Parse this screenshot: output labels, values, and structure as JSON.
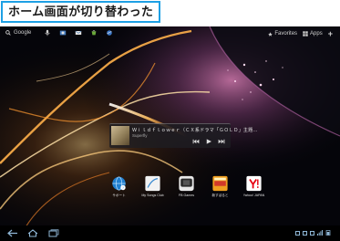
{
  "caption": "ホーム画面が切り替わった",
  "topbar": {
    "search_label": "Google",
    "favorites_label": "Favorites",
    "apps_label": "Apps",
    "add_label": "+"
  },
  "music_widget": {
    "title": "Ｗｉｌｄｆｌｏｗｅｒ（ＣＸ系ドラマ「ＧＯＬＤ」主題...",
    "artist": "Superfly"
  },
  "apps": [
    {
      "label": "サポート",
      "icon": "support-globe-icon",
      "color": "#1f7fd0"
    },
    {
      "label": "My Songs Club",
      "icon": "my-songs-club-icon",
      "color": "#f2f2f2"
    },
    {
      "label": "FB Games",
      "icon": "fb-games-icon",
      "color": "#e8e8e8"
    },
    {
      "label": "新すぽると",
      "icon": "sports-news-icon",
      "color": "#f0a020"
    },
    {
      "label": "Yahoo! JAPAN",
      "icon": "yahoo-japan-icon",
      "color": "#ffffff"
    }
  ],
  "colors": {
    "caption_border": "#1ea0e4",
    "accent": "#33b5e5"
  }
}
